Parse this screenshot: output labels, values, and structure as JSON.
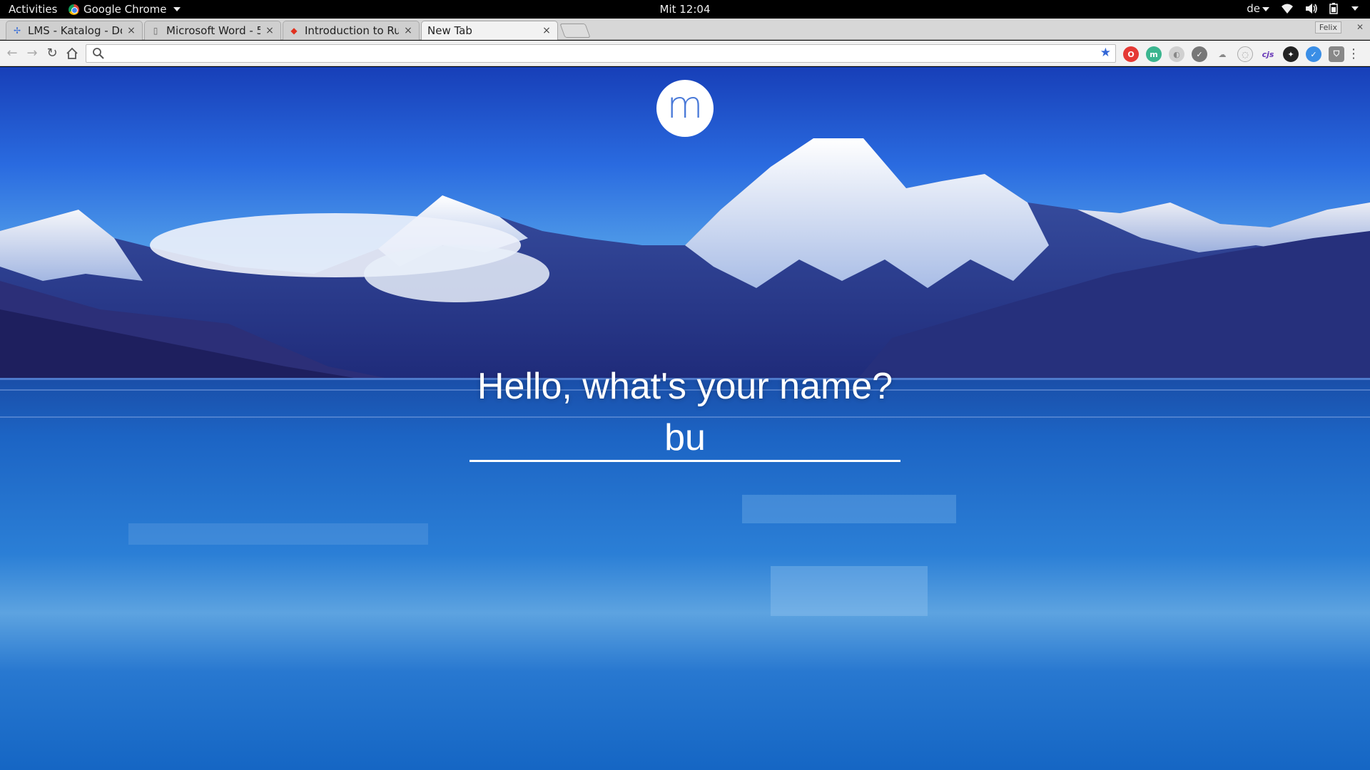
{
  "topbar": {
    "activities": "Activities",
    "app_name": "Google Chrome",
    "clock": "Mit 12:04",
    "keyboard_layout": "de"
  },
  "tabs": [
    {
      "title": "LMS - Katalog - Do",
      "icon": "lms-favicon",
      "active": false
    },
    {
      "title": "Microsoft Word - 5",
      "icon": "document-icon",
      "active": false
    },
    {
      "title": "Introduction to Ruby",
      "icon": "ruby-icon",
      "active": false
    },
    {
      "title": "New Tab",
      "icon": "",
      "active": true
    }
  ],
  "profile_label": "Felix",
  "omnibox": {
    "value": "",
    "placeholder": ""
  },
  "extensions": [
    "opera-icon",
    "momentum-icon",
    "sync-icon",
    "check-icon",
    "cloud-icon",
    "globe-icon",
    "cjs-icon",
    "vpn-icon",
    "check-blue-icon",
    "shield-icon"
  ],
  "momentum": {
    "logo_letter": "m",
    "prompt": "Hello, what's your name?",
    "name_value": "bu"
  },
  "colors": {
    "accent": "#3367d6",
    "sky_top": "#173fb8",
    "lake": "#1e72cc"
  }
}
